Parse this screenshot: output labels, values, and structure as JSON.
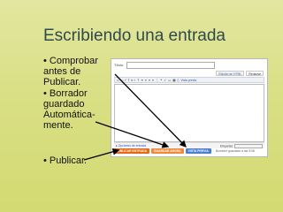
{
  "slide": {
    "title": "Escribiendo una entrada",
    "bullets": [
      "• Comprobar antes de Publicar.",
      "• Borrador guardado Automática-mente.",
      "• Publicar."
    ]
  },
  "editor": {
    "title_label": "Título:",
    "tabs": [
      "Edición de HTML",
      "Redactar"
    ],
    "toolbar": [
      "⎌",
      "⎌",
      "f",
      "T",
      "b",
      "i",
      "T",
      "⚭",
      "≡",
      "≡",
      "≡",
      "⋮",
      "❝",
      "✓",
      "▭",
      "▦",
      "▯",
      "Vista previa"
    ],
    "footer_left": "▸ Opciones de entrada",
    "footer_right_label": "Etiquetas:",
    "buttons": {
      "publish": "PUBLICAR ENTRADA",
      "save": "GUARDAR AHORA",
      "preview": "VISTA PREVIA"
    },
    "autosave": "Borrador guardado a las 9:08"
  },
  "colors": {
    "background": "#d9df84",
    "title": "#2f4a4a",
    "publish_button": "#e46a1a",
    "preview_button": "#4a7fd1"
  }
}
